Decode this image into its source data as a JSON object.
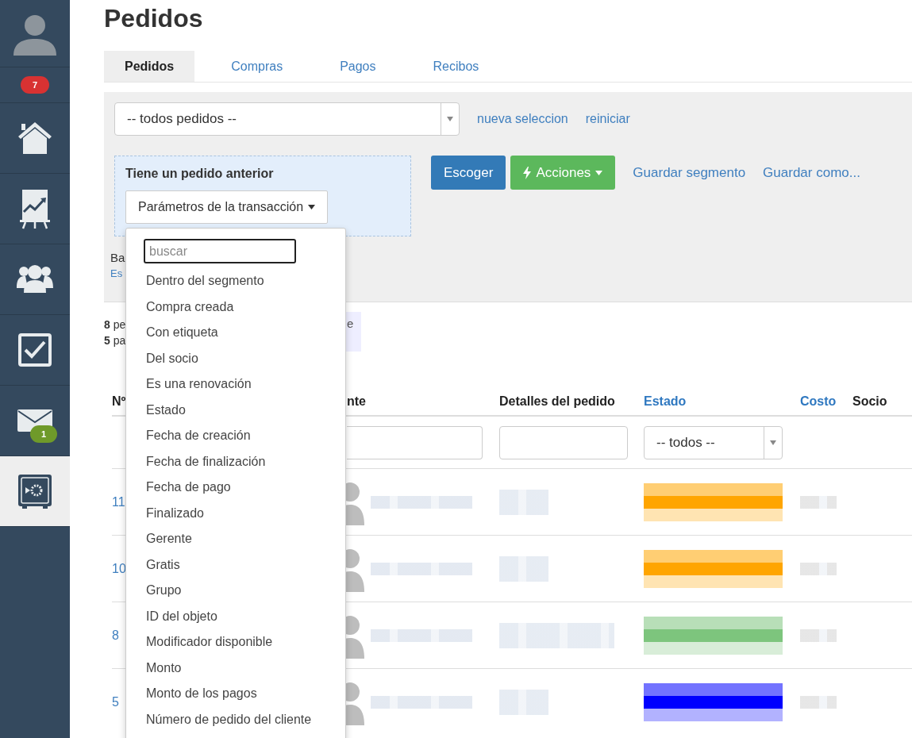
{
  "sidebar": {
    "items": [
      {
        "kind": "avatar",
        "selected": false
      },
      {
        "kind": "badge",
        "badge": "7"
      },
      {
        "kind": "home",
        "selected": false
      },
      {
        "kind": "chart",
        "selected": false
      },
      {
        "kind": "people",
        "selected": false
      },
      {
        "kind": "tasks",
        "selected": false
      },
      {
        "kind": "mail",
        "selected": false,
        "badge": "1"
      },
      {
        "kind": "safe",
        "selected": true
      }
    ]
  },
  "title": "Pedidos",
  "tabs": [
    {
      "label": "Pedidos",
      "selected": true
    },
    {
      "label": "Compras",
      "selected": false
    },
    {
      "label": "Pagos",
      "selected": false
    },
    {
      "label": "Recibos",
      "selected": false
    }
  ],
  "filter": {
    "segment_select": "-- todos pedidos --",
    "links": [
      "nueva seleccion",
      "reiniciar"
    ],
    "condition": {
      "title": "Tiene un pedido anterior",
      "button": "Parámetros de la transacción"
    },
    "choose_button": "Escoger",
    "actions_button": "Acciones",
    "save_links": [
      "Guardar segmento",
      "Guardar como..."
    ],
    "partial_label": "Ba",
    "partial_link": "Es"
  },
  "summary": {
    "lines": [
      "**8** pe",
      "**5** pa"
    ],
    "note": "e"
  },
  "table": {
    "columns": [
      {
        "label": "Nº",
        "sortable": false
      },
      {
        "label": "nte",
        "sortable": false
      },
      {
        "label": "Detalles del pedido",
        "sortable": false
      },
      {
        "label": "Estado",
        "sortable": true
      },
      {
        "label": "Costo",
        "sortable": true
      },
      {
        "label": "Socio",
        "sortable": false
      }
    ],
    "status_filter": "-- todos --",
    "rows": [
      {
        "number": "11",
        "color": "#ffa500"
      },
      {
        "number": "10",
        "color": "#ffa500"
      },
      {
        "number": "8",
        "color": "#7dc57d"
      },
      {
        "number": "5",
        "color": "#0000ff"
      }
    ]
  },
  "dropdown": {
    "placeholder": "buscar",
    "items": [
      "Dentro del segmento",
      "Compra creada",
      "Con etiqueta",
      "Del socio",
      "Es una renovación",
      "Estado",
      "Fecha de creación",
      "Fecha de finalización",
      "Fecha de pago",
      "Finalizado",
      "Gerente",
      "Gratis",
      "Grupo",
      "ID del objeto",
      "Modificador disponible",
      "Monto",
      "Monto de los pagos",
      "Número de pedido del cliente"
    ]
  }
}
